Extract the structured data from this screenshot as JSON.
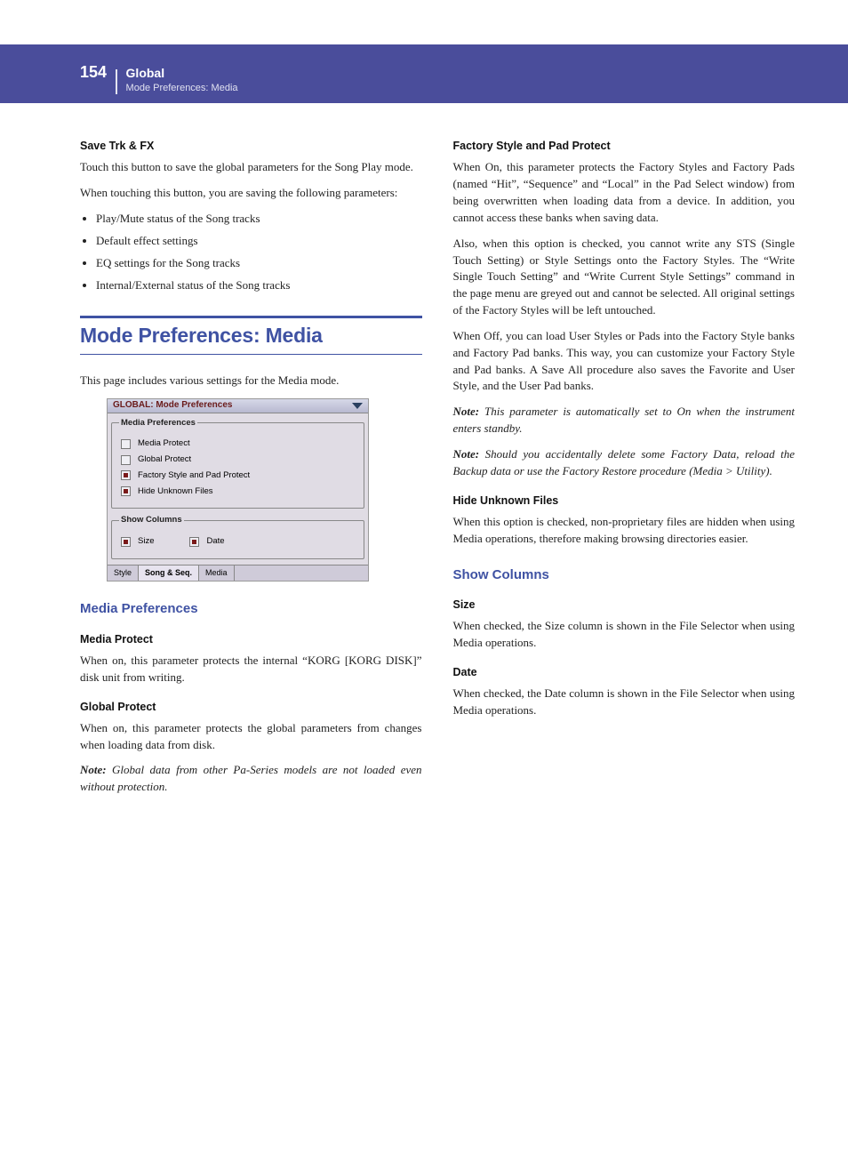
{
  "header": {
    "page_number": "154",
    "chapter": "Global",
    "breadcrumb": "Mode Preferences: Media"
  },
  "column1": {
    "save_trk": {
      "title": "Save Trk & FX",
      "p1": "Touch this button to save the global parameters for the Song Play mode.",
      "p2": "When touching this button, you are saving the following parameters:",
      "bullets": [
        "Play/Mute status of the Song tracks",
        "Default effect settings",
        "EQ settings for the Song tracks",
        "Internal/External status of the Song tracks"
      ]
    },
    "section_title": "Mode Preferences: Media",
    "intro": "This page includes various settings for the Media mode.",
    "screenshot": {
      "title": "GLOBAL: Mode Preferences",
      "fs1_legend": "Media Preferences",
      "opt1": "Media Protect",
      "opt2": "Global Protect",
      "opt3": "Factory Style and Pad Protect",
      "opt4": "Hide Unknown Files",
      "fs2_legend": "Show Columns",
      "size": "Size",
      "date": "Date",
      "tab1": "Style",
      "tab2": "Song & Seq.",
      "tab3": "Media"
    },
    "media_prefs_heading": "Media Preferences",
    "media_protect": {
      "title": "Media Protect",
      "p1": "When on, this parameter protects the internal “KORG [KORG DISK]” disk unit from writing."
    },
    "global_protect": {
      "title": "Global Protect",
      "p1": "When on, this parameter protects the global parameters from changes when loading data from disk.",
      "note": "Global data from other Pa-Series models are not loaded even without protection."
    }
  },
  "column2": {
    "factory": {
      "title": "Factory Style and Pad Protect",
      "p1": "When On, this parameter protects the Factory Styles and Factory Pads (named “Hit”, “Sequence” and “Local” in the Pad Select window) from being overwritten when loading data from a device. In addition, you cannot access these banks when saving data.",
      "p2": "Also, when this option is checked, you cannot write any STS (Single Touch Setting) or Style Settings onto the Factory Styles. The “Write Single Touch Setting” and “Write Current Style Settings” command in the page menu are greyed out and cannot be selected. All original settings of the Factory Styles will be left untouched.",
      "p3": "When Off, you can load User Styles or Pads into the Factory Style banks and Factory Pad banks. This way, you can customize your Factory Style and Pad banks. A Save All procedure also saves the Favorite and User Style, and the User Pad banks.",
      "note1": "This parameter is automatically set to On when the instrument enters standby.",
      "note2": "Should you accidentally delete some Factory Data, reload the Backup data or use the Factory Restore procedure (Media > Utility)."
    },
    "hide_unknown": {
      "title": "Hide Unknown Files",
      "p1": "When this option is checked, non-proprietary files are hidden when using Media operations, therefore making browsing directories easier."
    },
    "show_columns_heading": "Show Columns",
    "size": {
      "title": "Size",
      "p1": "When checked, the Size column is shown in the File Selector when using Media operations."
    },
    "date": {
      "title": "Date",
      "p1": "When checked, the Date column is shown in the File Selector when using Media operations."
    }
  }
}
